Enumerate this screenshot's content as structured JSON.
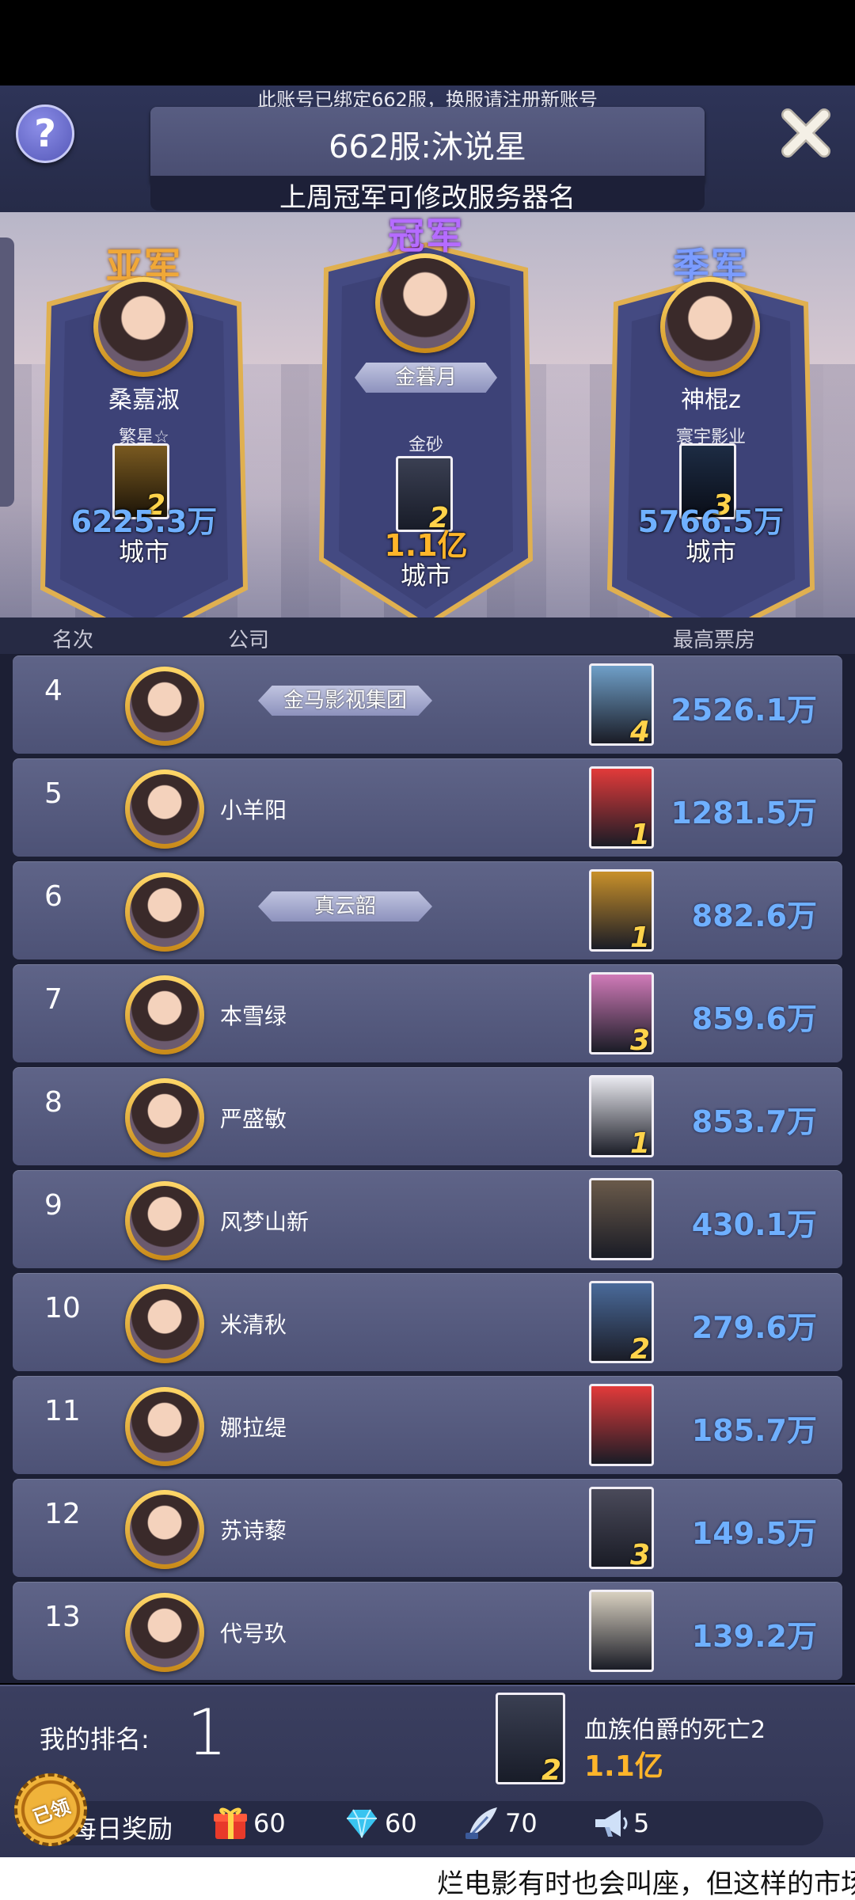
{
  "top_notice": "此账号已绑定662服，换服请注册新账号",
  "header": {
    "server_name": "662服:沐说星",
    "subtitle": "上周冠军可修改服务器名",
    "help_label": "?"
  },
  "podium": {
    "second": {
      "title": "亚军",
      "player": "桑嘉淑",
      "company": "繁星☆",
      "poster_num": "2",
      "amount": "6225.3万",
      "city": "城市"
    },
    "first": {
      "title": "冠军",
      "player": "金暮月",
      "company": "金砂",
      "poster_num": "2",
      "amount": "1.1亿",
      "city": "城市"
    },
    "third": {
      "title": "季军",
      "player": "神棍z",
      "company": "寰宇影业",
      "poster_num": "3",
      "amount": "5766.5万",
      "city": "城市"
    }
  },
  "columns": {
    "rank": "名次",
    "company": "公司",
    "box_office": "最高票房"
  },
  "rows": [
    {
      "rank": "4",
      "name": "金马影视集团",
      "badge": true,
      "poster_num": "4",
      "amount": "2526.1万"
    },
    {
      "rank": "5",
      "name": "小羊阳",
      "badge": false,
      "poster_num": "1",
      "amount": "1281.5万"
    },
    {
      "rank": "6",
      "name": "真云韶",
      "badge": true,
      "poster_num": "1",
      "amount": "882.6万"
    },
    {
      "rank": "7",
      "name": "本雪绿",
      "badge": false,
      "poster_num": "3",
      "amount": "859.6万"
    },
    {
      "rank": "8",
      "name": "严盛敏",
      "badge": false,
      "poster_num": "1",
      "amount": "853.7万"
    },
    {
      "rank": "9",
      "name": "风梦山新",
      "badge": false,
      "poster_num": "",
      "amount": "430.1万"
    },
    {
      "rank": "10",
      "name": "米清秋",
      "badge": false,
      "poster_num": "2",
      "amount": "279.6万"
    },
    {
      "rank": "11",
      "name": "娜拉缇",
      "badge": false,
      "poster_num": "",
      "amount": "185.7万"
    },
    {
      "rank": "12",
      "name": "苏诗藜",
      "badge": false,
      "poster_num": "3",
      "amount": "149.5万"
    },
    {
      "rank": "13",
      "name": "代号玖",
      "badge": false,
      "poster_num": "",
      "amount": "139.2万"
    }
  ],
  "my_rank": {
    "label": "我的排名:",
    "value": "1",
    "poster_num": "2",
    "movie_title": "血族伯爵的死亡2",
    "movie_amount": "1.1亿"
  },
  "daily_reward": {
    "label": "每日奖励",
    "stamp": "已领",
    "items": [
      {
        "icon": "gift-icon",
        "value": "60"
      },
      {
        "icon": "diamond-icon",
        "value": "60"
      },
      {
        "icon": "quill-icon",
        "value": "70"
      },
      {
        "icon": "megaphone-icon",
        "value": "5"
      }
    ]
  },
  "ticker": "烂电影有时也会叫座，但这样的市场",
  "colors": {
    "blue_amount": "#6fb0ff",
    "gold_amount": "#ffb52a",
    "row_bg": "#565b80"
  }
}
